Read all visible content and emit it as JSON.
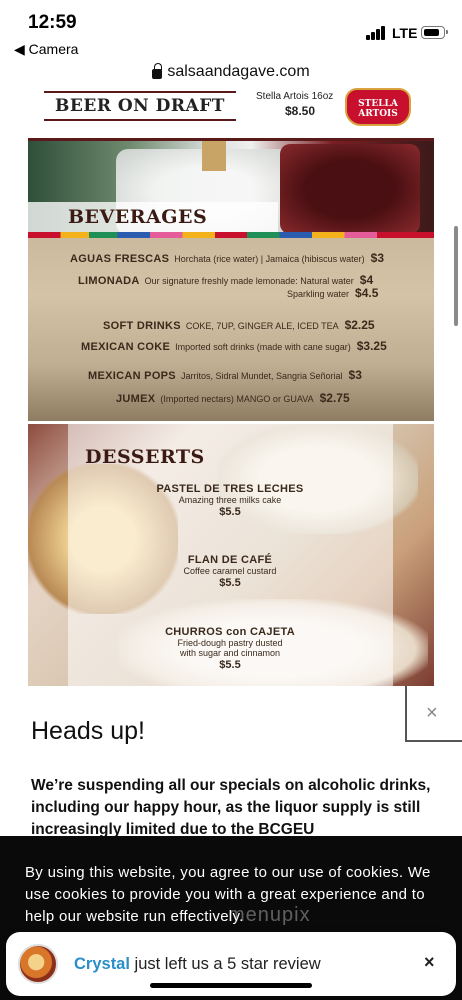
{
  "status_bar": {
    "time": "12:59",
    "back_label": "◀ Camera",
    "network": "LTE"
  },
  "browser": {
    "url": "salsaandagave.com"
  },
  "menu": {
    "beer_header": "BEER ON DRAFT",
    "stella_name": "Stella Artois 16oz",
    "stella_price": "$8.50",
    "stella_logo": "STELLA ARTOIS",
    "beverages_title": "BEVERAGES",
    "beverages": [
      {
        "name": "AGUAS FRESCAS",
        "desc": "Horchata (rice water) | Jamaica (hibiscus water)",
        "price": "$3"
      },
      {
        "name": "LIMONADA",
        "desc": "Our signature freshly made lemonade: Natural water",
        "price": "$4"
      },
      {
        "name": "",
        "desc": "Sparkling water",
        "price": "$4.5"
      },
      {
        "name": "SOFT DRINKS",
        "desc": "COKE, 7UP, GINGER ALE, ICED TEA",
        "price": "$2.25"
      },
      {
        "name": "MEXICAN COKE",
        "desc": "Imported soft drinks (made with cane sugar)",
        "price": "$3.25"
      },
      {
        "name": "MEXICAN POPS",
        "desc": "Jarritos, Sidral Mundet, Sangria Señorial",
        "price": "$3"
      },
      {
        "name": "JUMEX",
        "desc": "(Imported nectars) MANGO or GUAVA",
        "price": "$2.75"
      }
    ],
    "desserts_title": "DESSERTS",
    "desserts": [
      {
        "name": "PASTEL DE TRES LECHES",
        "desc": "Amazing three milks cake",
        "price": "$5.5"
      },
      {
        "name": "FLAN DE CAFÉ",
        "desc": "Coffee caramel custard",
        "price": "$5.5"
      },
      {
        "name": "CHURROS con CAJETA",
        "desc": "Fried-dough pastry dusted with sugar and cinnamon",
        "price": "$5.5"
      }
    ]
  },
  "modal": {
    "title": "Heads up!",
    "text": "We’re suspending all our specials on alcoholic drinks, including our happy hour, as the liquor supply is still increasingly limited due to the BCGEU",
    "close": "×"
  },
  "cookie": {
    "text": "By using this website, you agree to our use of cookies. We use cookies to provide you with a great experience and to help our website run effectively.",
    "watermark": "menupix"
  },
  "toast": {
    "name": "Crystal",
    "message": " just left us a 5 star review",
    "close": "×"
  }
}
